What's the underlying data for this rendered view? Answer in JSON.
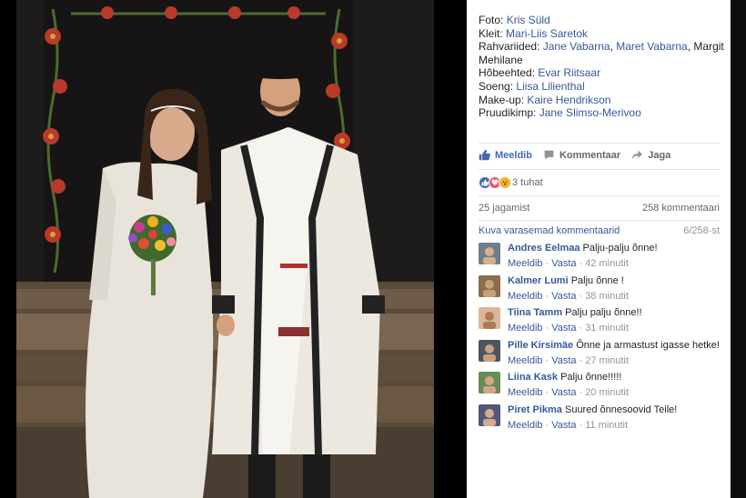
{
  "credits": [
    {
      "label": "Foto:",
      "names": [
        "Kris Süld"
      ],
      "plain": ""
    },
    {
      "label": "Kleit:",
      "names": [
        "Mari-Liis Saretok"
      ],
      "plain": ""
    },
    {
      "label": "Rahvariided:",
      "names": [
        "Jane Vabarna",
        "Maret Vabarna"
      ],
      "plain": ", Margit Mehilane"
    },
    {
      "label": "Hõbeehted:",
      "names": [
        "Evar Riitsaar"
      ],
      "plain": ""
    },
    {
      "label": "Soeng:",
      "names": [
        "Liisa Lilienthal"
      ],
      "plain": ""
    },
    {
      "label": "Make-up:",
      "names": [
        "Kaire Hendrikson"
      ],
      "plain": ""
    },
    {
      "label": "Pruudikimp:",
      "names": [
        "Jane Slimso-Merivoo"
      ],
      "plain": ""
    }
  ],
  "actions": {
    "like": "Meeldib",
    "comment": "Kommentaar",
    "share": "Jaga"
  },
  "reactions": {
    "count": "3 tuhat"
  },
  "stats": {
    "shares": "25 jagamist",
    "comments": "258 kommentaari"
  },
  "comments_header": {
    "more": "Kuva varasemad kommentaarid",
    "counter": "6/258-st"
  },
  "comments": [
    {
      "author": "Andres Eelmaa",
      "text": "Palju-palju õnne!",
      "like": "Meeldib",
      "reply": "Vasta",
      "time": "42 minutit"
    },
    {
      "author": "Kalmer Lumi",
      "text": "Palju õnne !",
      "like": "Meeldib",
      "reply": "Vasta",
      "time": "38 minutit"
    },
    {
      "author": "Tiina Tamm",
      "text": "Palju palju õnne!!",
      "like": "Meeldib",
      "reply": "Vasta",
      "time": "31 minutit"
    },
    {
      "author": "Pille Kirsimäe",
      "text": "Õnne ja armastust igasse hetke!",
      "like": "Meeldib",
      "reply": "Vasta",
      "time": "27 minutit"
    },
    {
      "author": "Liina Kask",
      "text": "Palju õnne!!!!!",
      "like": "Meeldib",
      "reply": "Vasta",
      "time": "20 minutit"
    },
    {
      "author": "Piret Pikma",
      "text": "Suured õnnesoovid Teile!",
      "like": "Meeldib",
      "reply": "Vasta",
      "time": "11 minutit"
    }
  ],
  "colors": {
    "link": "#365899",
    "like_blue": "#4267b2",
    "muted": "#90949c",
    "love": "#f25268",
    "wow": "#f7b125"
  },
  "icons": {
    "like": "thumbs-up-icon",
    "comment": "comment-bubble-icon",
    "share": "share-arrow-icon"
  }
}
